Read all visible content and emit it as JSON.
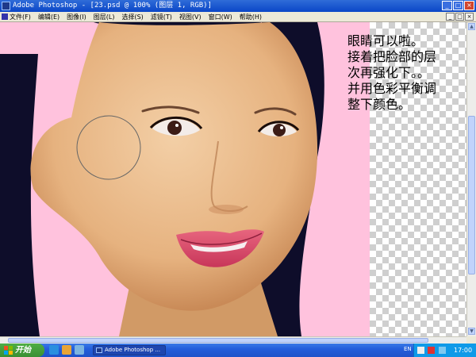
{
  "window": {
    "title": "Adobe Photoshop - [23.psd @ 100% (图层 1, RGB)]",
    "controls": [
      "_",
      "□",
      "×"
    ]
  },
  "menubar": {
    "items": [
      "文件(F)",
      "编辑(E)",
      "图像(I)",
      "图层(L)",
      "选择(S)",
      "滤镜(T)",
      "视图(V)",
      "窗口(W)",
      "帮助(H)"
    ],
    "doc_controls": [
      "_",
      "□",
      "×"
    ]
  },
  "canvas": {
    "background_color": "#ffc2dd",
    "note_lines": [
      "眼睛可以啦。",
      "接着把脸部的层",
      "次再强化下。。",
      "并用色彩平衡调",
      "整下颜色。"
    ],
    "brush_cursor": "circle-brush-cursor"
  },
  "taskbar": {
    "start_label": "开始",
    "task_label": "Adobe Photoshop ...",
    "language": "EN",
    "clock": "17:00"
  },
  "colors": {
    "title_bar": "#0a46c7",
    "taskbar": "#245edb",
    "start_button": "#3a8f34",
    "tray": "#0f9ae8"
  }
}
